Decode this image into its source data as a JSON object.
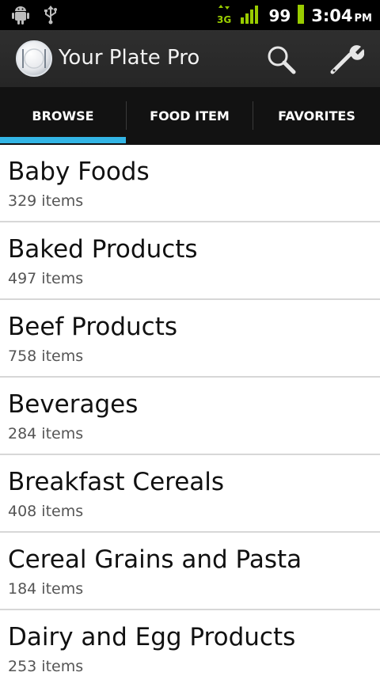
{
  "status_bar": {
    "network_type": "3G",
    "battery_level": "99",
    "time": "3:04",
    "ampm": "PM",
    "icons": [
      "android-debug-icon",
      "usb-icon",
      "data-3g-icon",
      "signal-icon",
      "battery-icon"
    ]
  },
  "app_bar": {
    "title": "Your Plate Pro",
    "icons": [
      "plate-logo-icon",
      "search-icon",
      "wrench-settings-icon"
    ]
  },
  "tabs": [
    {
      "label": "BROWSE",
      "selected": true
    },
    {
      "label": "FOOD ITEM",
      "selected": false
    },
    {
      "label": "FAVORITES",
      "selected": false
    }
  ],
  "categories": [
    {
      "name": "Baby Foods",
      "count": "329 items"
    },
    {
      "name": "Baked Products",
      "count": "497 items"
    },
    {
      "name": "Beef Products",
      "count": "758 items"
    },
    {
      "name": "Beverages",
      "count": "284 items"
    },
    {
      "name": "Breakfast Cereals",
      "count": "408 items"
    },
    {
      "name": "Cereal Grains and Pasta",
      "count": "184 items"
    },
    {
      "name": "Dairy and Egg Products",
      "count": "253 items"
    }
  ],
  "colors": {
    "accent": "#33b5e5",
    "signal": "#99cc00",
    "status_bar_bg": "#000000",
    "action_bar_bg": "#2b2b2b",
    "tab_bar_bg": "#121212"
  }
}
